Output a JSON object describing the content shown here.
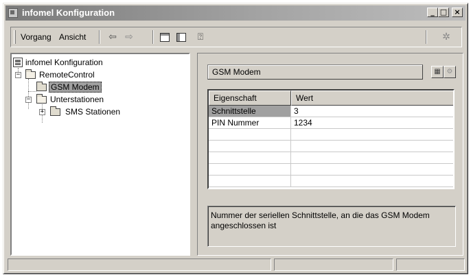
{
  "window": {
    "title": "infomel Konfiguration"
  },
  "menu": {
    "vorgang": "Vorgang",
    "ansicht": "Ansicht"
  },
  "tree": {
    "root": "infomel Konfiguration",
    "remote_control": "RemoteControl",
    "gsm_modem": "GSM Modem",
    "unterstationen": "Unterstationen",
    "sms_stationen": "SMS Stationen"
  },
  "details": {
    "header": "GSM Modem",
    "columns": {
      "property": "Eigenschaft",
      "value": "Wert"
    },
    "rows": [
      {
        "property": "Schnittstelle",
        "value": "3"
      },
      {
        "property": "PIN Nummer",
        "value": "1234"
      }
    ],
    "description": "Nummer der seriellen Schnittstelle, an die das GSM Modem angeschlossen ist"
  },
  "icons": {
    "back": "arrow-left-icon",
    "forward": "arrow-right-icon",
    "up": "up-one-level-icon",
    "tree": "show-hide-tree-icon",
    "help": "help-icon",
    "action": "action-icon"
  }
}
